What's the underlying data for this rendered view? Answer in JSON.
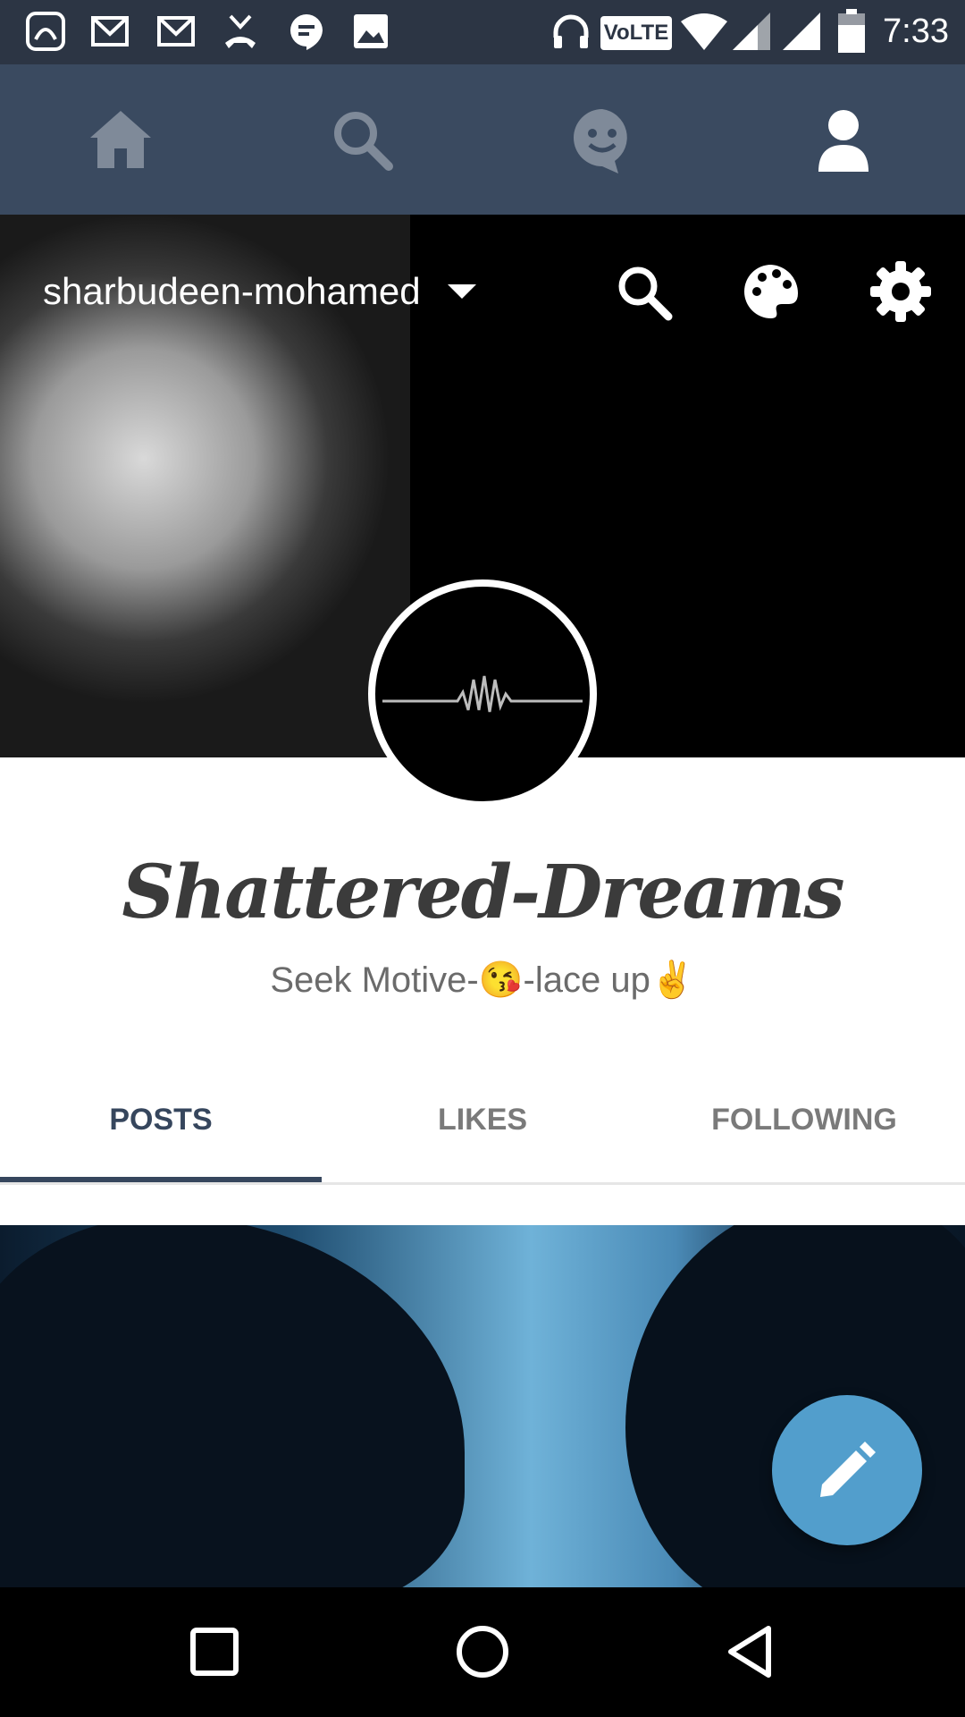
{
  "status_bar": {
    "time": "7:33",
    "volte_label": "VoLTE",
    "icons": [
      "saavn-icon",
      "gmail-icon",
      "gmail-icon",
      "missed-call-icon",
      "hangouts-icon",
      "image-icon",
      "headphones-icon",
      "volte-icon",
      "wifi-icon",
      "signal-icon",
      "signal-icon",
      "battery-icon"
    ]
  },
  "nav": {
    "items": [
      {
        "name": "home-icon",
        "active": false
      },
      {
        "name": "search-icon",
        "active": false
      },
      {
        "name": "messages-icon",
        "active": false
      },
      {
        "name": "account-icon",
        "active": true
      }
    ]
  },
  "profile": {
    "blog_name": "sharbudeen-mohamed",
    "title": "Shattered-Dreams",
    "description": "Seek Motive-😘-lace up✌️"
  },
  "tabs": [
    {
      "label": "POSTS",
      "active": true
    },
    {
      "label": "LIKES",
      "active": false
    },
    {
      "label": "FOLLOWING",
      "active": false
    }
  ],
  "colors": {
    "nav_bg": "#3a4a60",
    "status_bg": "#2c3544",
    "accent": "#36465d",
    "fab": "#529ecc"
  }
}
